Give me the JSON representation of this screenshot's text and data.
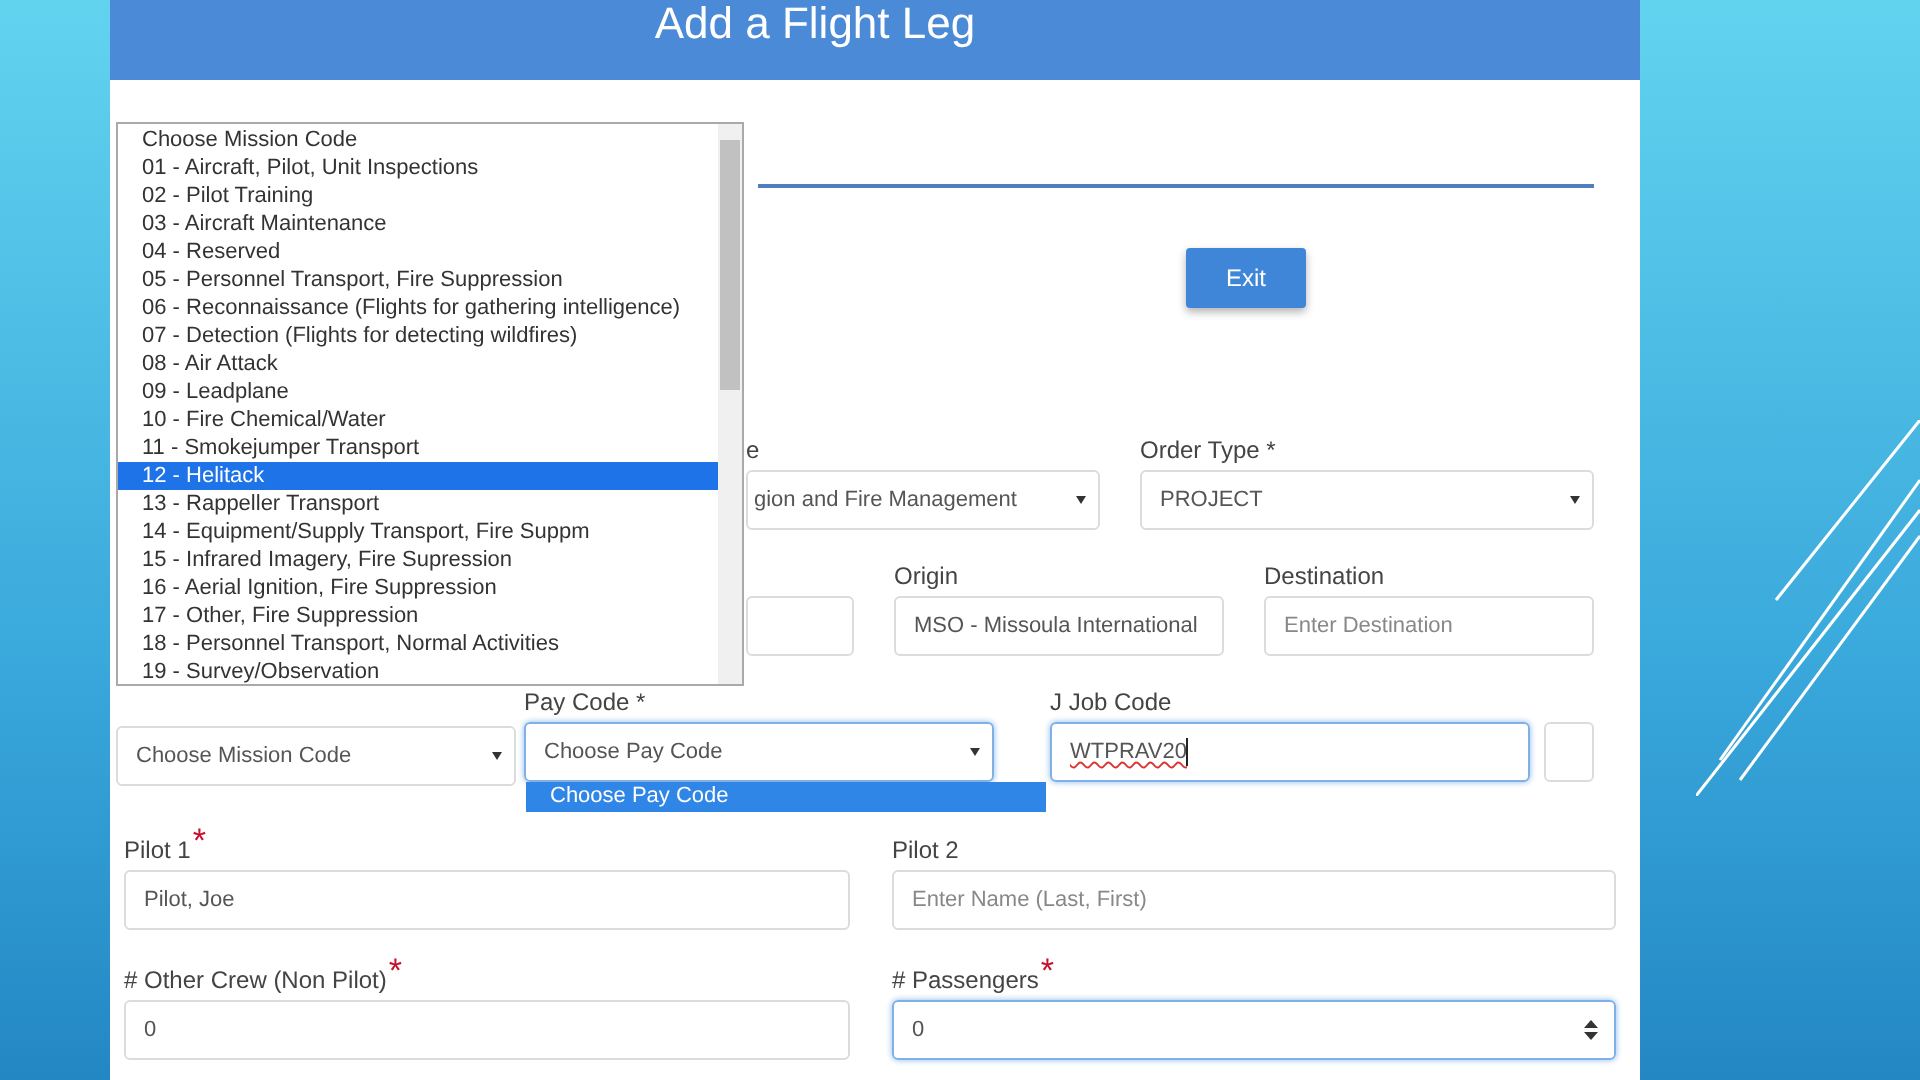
{
  "header": {
    "title": "Add a Flight Leg"
  },
  "exit_button": {
    "label": "Exit"
  },
  "rows": [
    {
      "fields": [
        {
          "label": "e",
          "kind": "select",
          "value": "gion and Fire Management",
          "focused": false
        },
        {
          "label": "Order Type *",
          "kind": "select",
          "value": "PROJECT",
          "focused": false
        }
      ]
    },
    {
      "fields": [
        {
          "kind": "text",
          "focused": false
        },
        {
          "label": "Origin",
          "kind": "text",
          "value": "MSO - Missoula International",
          "focused": false
        },
        {
          "label": "Destination",
          "kind": "text",
          "placeholder": "Enter Destination",
          "focused": false
        }
      ]
    },
    {
      "fields": [
        {
          "kind": "select",
          "value": "Choose Mission Code",
          "focused": false
        },
        {
          "label": "Pay Code *",
          "kind": "select",
          "value": "Choose Pay Code",
          "focused": true,
          "options": [
            {
              "label": "Choose Pay Code",
              "selected": true
            }
          ]
        },
        {
          "label": "J Job Code",
          "kind": "text",
          "value": "WTPRAV20",
          "focused": true,
          "misspelled": true
        },
        {
          "kind": "text",
          "focused": false
        }
      ]
    },
    {
      "fields": [
        {
          "label": "Pilot 1",
          "required_mark": "*",
          "kind": "text",
          "value": "Pilot, Joe",
          "focused": false
        },
        {
          "label": "Pilot 2",
          "kind": "text",
          "placeholder": "Enter Name (Last, First)",
          "focused": false
        }
      ]
    },
    {
      "fields": [
        {
          "label": "# Other Crew (Non Pilot)",
          "required_mark": "*",
          "kind": "text",
          "value": "0",
          "focused": false
        },
        {
          "label": "# Passengers",
          "required_mark": "*",
          "kind": "number",
          "value": "0",
          "focused": true
        }
      ]
    }
  ],
  "mission_code_list": {
    "options": [
      {
        "label": "Choose Mission Code",
        "selected": false
      },
      {
        "label": "01 - Aircraft, Pilot, Unit Inspections",
        "selected": false
      },
      {
        "label": "02 - Pilot Training",
        "selected": false
      },
      {
        "label": "03 - Aircraft Maintenance",
        "selected": false
      },
      {
        "label": "04 - Reserved",
        "selected": false
      },
      {
        "label": "05 - Personnel Transport, Fire Suppression",
        "selected": false
      },
      {
        "label": "06 - Reconnaissance (Flights for gathering intelligence)",
        "selected": false
      },
      {
        "label": "07 - Detection (Flights for detecting wildfires)",
        "selected": false
      },
      {
        "label": "08 - Air Attack",
        "selected": false
      },
      {
        "label": "09 - Leadplane",
        "selected": false
      },
      {
        "label": "10 - Fire Chemical/Water",
        "selected": false
      },
      {
        "label": "11 - Smokejumper Transport",
        "selected": false
      },
      {
        "label": "12 - Helitack",
        "selected": true
      },
      {
        "label": "13 - Rappeller Transport",
        "selected": false
      },
      {
        "label": "14 - Equipment/Supply Transport, Fire Suppm",
        "selected": false
      },
      {
        "label": "15 - Infrared Imagery, Fire Supression",
        "selected": false
      },
      {
        "label": "16 - Aerial Ignition, Fire Suppression",
        "selected": false
      },
      {
        "label": "17 - Other, Fire Suppression",
        "selected": false
      },
      {
        "label": "18 - Personnel Transport, Normal Activities",
        "selected": false
      },
      {
        "label": "19 - Survey/Observation",
        "selected": false
      }
    ]
  }
}
